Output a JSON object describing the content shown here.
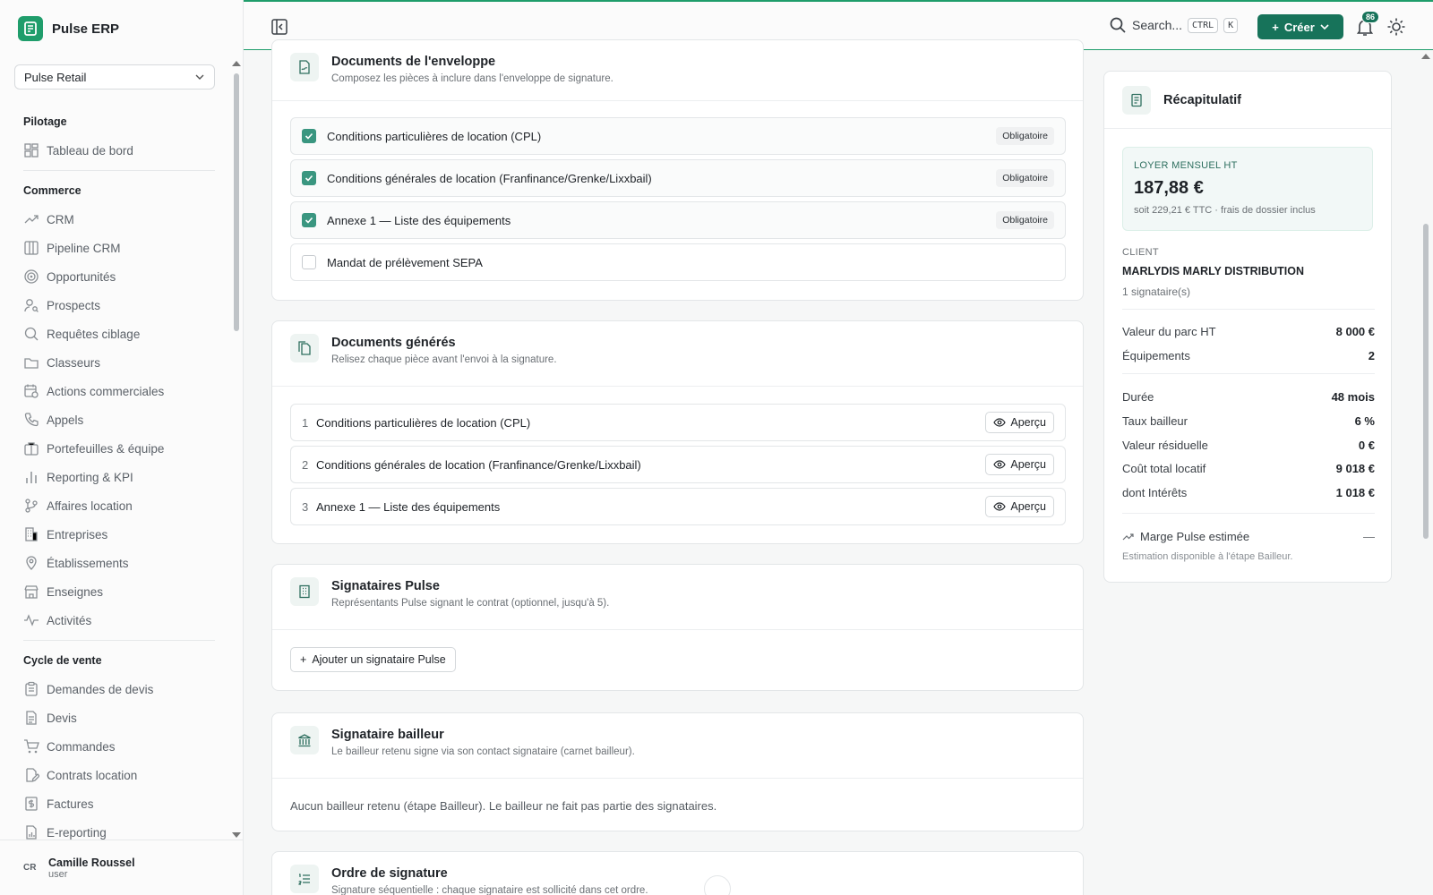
{
  "brand": {
    "name": "Pulse ERP",
    "accent": "#1f9d6b"
  },
  "org_select": {
    "value": "Pulse Retail"
  },
  "nav": {
    "sections": [
      {
        "title": "Pilotage",
        "items": [
          {
            "label": "Tableau de bord",
            "icon": "dashboard-icon"
          }
        ]
      },
      {
        "title": "Commerce",
        "items": [
          {
            "label": "CRM",
            "icon": "trend-icon"
          },
          {
            "label": "Pipeline CRM",
            "icon": "columns-icon"
          },
          {
            "label": "Opportunités",
            "icon": "target-icon"
          },
          {
            "label": "Prospects",
            "icon": "user-search-icon"
          },
          {
            "label": "Requêtes ciblage",
            "icon": "search-icon"
          },
          {
            "label": "Classeurs",
            "icon": "folder-icon"
          },
          {
            "label": "Actions commerciales",
            "icon": "calendar-clock-icon"
          },
          {
            "label": "Appels",
            "icon": "phone-icon"
          },
          {
            "label": "Portefeuilles & équipe",
            "icon": "briefcase-icon"
          },
          {
            "label": "Reporting & KPI",
            "icon": "bar-chart-icon"
          },
          {
            "label": "Affaires location",
            "icon": "branch-icon"
          },
          {
            "label": "Entreprises",
            "icon": "building-icon"
          },
          {
            "label": "Établissements",
            "icon": "map-pin-icon"
          },
          {
            "label": "Enseignes",
            "icon": "store-icon"
          },
          {
            "label": "Activités",
            "icon": "activity-icon"
          }
        ]
      },
      {
        "title": "Cycle de vente",
        "items": [
          {
            "label": "Demandes de devis",
            "icon": "clipboard-icon"
          },
          {
            "label": "Devis",
            "icon": "file-text-icon"
          },
          {
            "label": "Commandes",
            "icon": "cart-icon"
          },
          {
            "label": "Contrats location",
            "icon": "file-edit-icon"
          },
          {
            "label": "Factures",
            "icon": "invoice-icon"
          },
          {
            "label": "E-reporting",
            "icon": "file-chart-icon"
          }
        ]
      }
    ]
  },
  "user": {
    "initials": "CR",
    "name": "Camille Roussel",
    "role": "user"
  },
  "topbar": {
    "search_label": "Search...",
    "kbd_ctrl": "CTRL",
    "kbd_k": "K",
    "create_label": "Créer",
    "notifications_count": "86"
  },
  "envelope": {
    "title": "Documents de l'enveloppe",
    "subtitle": "Composez les pièces à inclure dans l'enveloppe de signature.",
    "docs": [
      {
        "label": "Conditions particulières de location (CPL)",
        "checked": true,
        "badge": "Obligatoire"
      },
      {
        "label": "Conditions générales de location (Franfinance/Grenke/Lixxbail)",
        "checked": true,
        "badge": "Obligatoire"
      },
      {
        "label": "Annexe 1 — Liste des équipements",
        "checked": true,
        "badge": "Obligatoire"
      },
      {
        "label": "Mandat de prélèvement SEPA",
        "checked": false,
        "badge": ""
      }
    ]
  },
  "generated": {
    "title": "Documents générés",
    "subtitle": "Relisez chaque pièce avant l'envoi à la signature.",
    "preview_label": "Aperçu",
    "docs": [
      {
        "num": "1",
        "label": "Conditions particulières de location (CPL)"
      },
      {
        "num": "2",
        "label": "Conditions générales de location (Franfinance/Grenke/Lixxbail)"
      },
      {
        "num": "3",
        "label": "Annexe 1 — Liste des équipements"
      }
    ]
  },
  "pulse_signers": {
    "title": "Signataires Pulse",
    "subtitle": "Représentants Pulse signant le contrat (optionnel, jusqu'à 5).",
    "add_label": "Ajouter un signataire Pulse"
  },
  "lessor_signer": {
    "title": "Signataire bailleur",
    "subtitle": "Le bailleur retenu signe via son contact signataire (carnet bailleur).",
    "empty_text": "Aucun bailleur retenu (étape Bailleur). Le bailleur ne fait pas partie des signataires."
  },
  "signature_order": {
    "title": "Ordre de signature",
    "subtitle": "Signature séquentielle : chaque signataire est sollicité dans cet ordre."
  },
  "summary": {
    "title": "Récapitulatif",
    "loyer_label": "LOYER MENSUEL HT",
    "loyer_value": "187,88 €",
    "loyer_sub": "soit 229,21 € TTC · frais de dossier inclus",
    "client_label": "CLIENT",
    "client_name": "MARLYDIS MARLY DISTRIBUTION",
    "client_signers": "1 signataire(s)",
    "kv": [
      {
        "k": "Valeur du parc HT",
        "v": "8 000 €"
      },
      {
        "k": "Équipements",
        "v": "2"
      },
      {
        "k": "Durée",
        "v": "48 mois"
      },
      {
        "k": "Taux bailleur",
        "v": "6 %"
      },
      {
        "k": "Valeur résiduelle",
        "v": "0 €"
      },
      {
        "k": "Coût total locatif",
        "v": "9 018 €"
      },
      {
        "k": "dont Intérêts",
        "v": "1 018 €"
      }
    ],
    "marge_label": "Marge Pulse estimée",
    "marge_value": "—",
    "marge_note": "Estimation disponible à l'étape Bailleur."
  }
}
